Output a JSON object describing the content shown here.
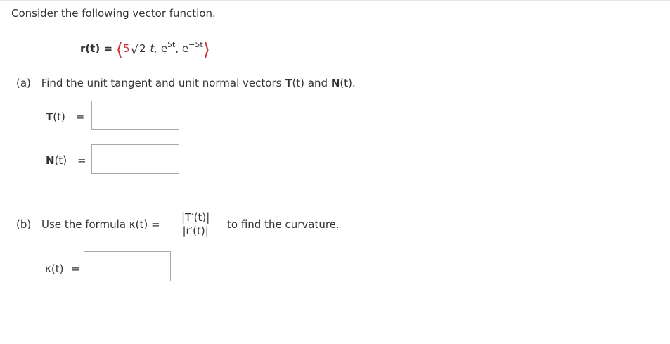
{
  "intro": "Consider the following vector function.",
  "function": {
    "lhs": "r(t) =",
    "open": "⟨",
    "c1_coeff": "5",
    "c1_radicand": "2",
    "c1_var": "t,",
    "c2_base": "e",
    "c2_exp": "5t",
    "c2_sep": ",",
    "c3_base": "e",
    "c3_exp": "−5t",
    "close": "⟩"
  },
  "part_a": {
    "label": "(a)",
    "text_before": "Find the unit tangent and unit normal vectors",
    "T": "T",
    "targ": "(t)",
    "and": "and",
    "N": "N",
    "narg": "(t).",
    "T_label_bold": "T",
    "T_label_rest": "(t)",
    "N_label_bold": "N",
    "N_label_rest": "(t)",
    "eq": "="
  },
  "part_b": {
    "label": "(b)",
    "text_before": "Use the formula κ(t) =",
    "frac_num": "|T′(t)|",
    "frac_den": "|r′(t)|",
    "text_after": "to find the curvature.",
    "kappa_label": "κ(t)",
    "eq": "="
  }
}
